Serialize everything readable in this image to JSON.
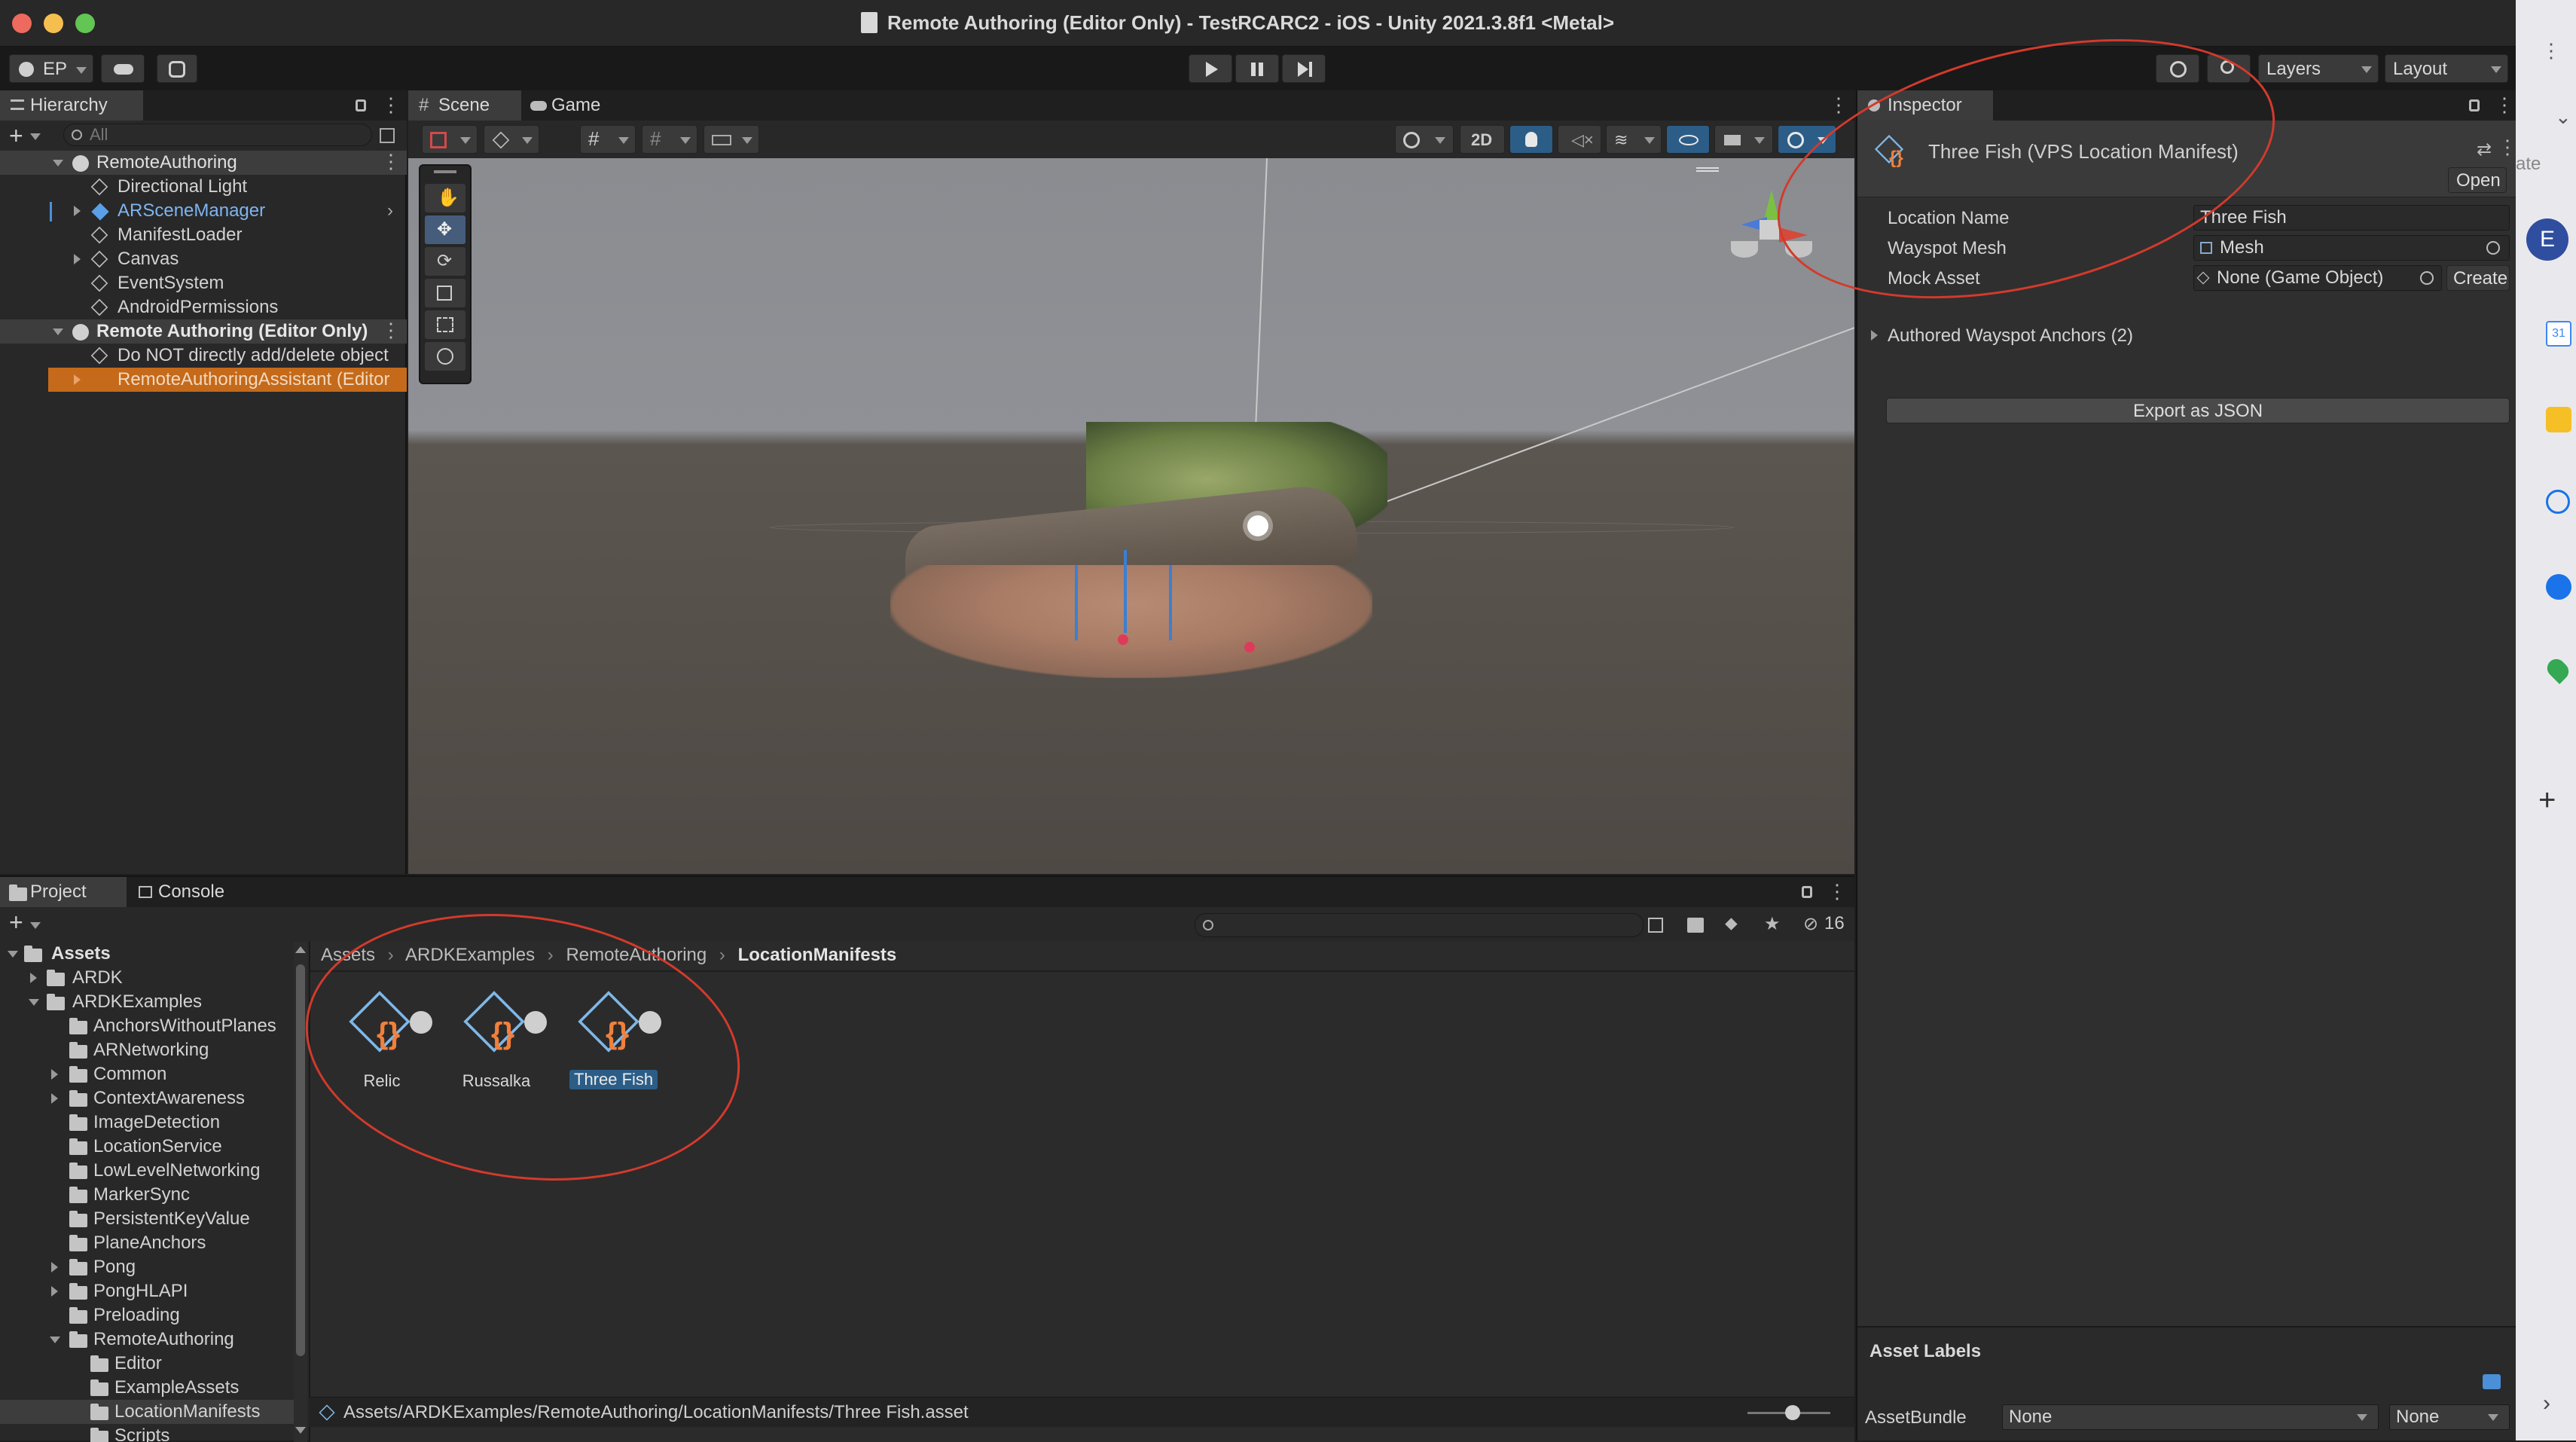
{
  "window": {
    "title": "Remote Authoring (Editor Only) - TestRCARC2 - iOS - Unity 2021.3.8f1 <Metal>"
  },
  "toolbar": {
    "account_label": "EP",
    "layers_label": "Layers",
    "layout_label": "Layout"
  },
  "hierarchy": {
    "tab_label": "Hierarchy",
    "search_placeholder": "All",
    "items": [
      {
        "label": "RemoteAuthoring",
        "indent": 0,
        "kind": "scene"
      },
      {
        "label": "Directional Light",
        "indent": 1,
        "kind": "object"
      },
      {
        "label": "ARSceneManager",
        "indent": 1,
        "kind": "prefab"
      },
      {
        "label": "ManifestLoader",
        "indent": 1,
        "kind": "object"
      },
      {
        "label": "Canvas",
        "indent": 1,
        "kind": "object"
      },
      {
        "label": "EventSystem",
        "indent": 1,
        "kind": "object"
      },
      {
        "label": "AndroidPermissions",
        "indent": 1,
        "kind": "object"
      },
      {
        "label": "Remote Authoring (Editor Only)",
        "indent": 0,
        "kind": "scene"
      },
      {
        "label": "Do NOT directly add/delete object",
        "indent": 1,
        "kind": "object"
      },
      {
        "label": "RemoteAuthoringAssistant (Editor",
        "indent": 1,
        "kind": "selected"
      }
    ]
  },
  "scene_view": {
    "tabs": [
      "Scene",
      "Game"
    ],
    "mode_2d": "2D"
  },
  "inspector": {
    "tab_label": "Inspector",
    "object_title": "Three Fish (VPS Location Manifest)",
    "open_button": "Open",
    "fields": {
      "location_name_label": "Location Name",
      "location_name_value": "Three Fish",
      "wayspot_mesh_label": "Wayspot Mesh",
      "wayspot_mesh_value": "Mesh",
      "mock_asset_label": "Mock Asset",
      "mock_asset_value": "None (Game Object)",
      "create_button": "Create"
    },
    "foldout_label": "Authored Wayspot Anchors (2)",
    "export_button": "Export as JSON",
    "asset_labels_title": "Asset Labels",
    "assetbundle_label": "AssetBundle",
    "assetbundle_value": "None",
    "assetbundle_variant": "None"
  },
  "project": {
    "tabs": [
      "Project",
      "Console"
    ],
    "hidden_count": "16",
    "breadcrumb": [
      "Assets",
      "ARDKExamples",
      "RemoteAuthoring",
      "LocationManifests"
    ],
    "tree": [
      {
        "label": "Assets",
        "indent": 0,
        "expanded": true,
        "bold": true
      },
      {
        "label": "ARDK",
        "indent": 1,
        "expandable": true
      },
      {
        "label": "ARDKExamples",
        "indent": 1,
        "expanded": true
      },
      {
        "label": "AnchorsWithoutPlanes",
        "indent": 2
      },
      {
        "label": "ARNetworking",
        "indent": 2
      },
      {
        "label": "Common",
        "indent": 2,
        "expandable": true
      },
      {
        "label": "ContextAwareness",
        "indent": 2,
        "expandable": true
      },
      {
        "label": "ImageDetection",
        "indent": 2
      },
      {
        "label": "LocationService",
        "indent": 2
      },
      {
        "label": "LowLevelNetworking",
        "indent": 2
      },
      {
        "label": "MarkerSync",
        "indent": 2
      },
      {
        "label": "PersistentKeyValue",
        "indent": 2
      },
      {
        "label": "PlaneAnchors",
        "indent": 2
      },
      {
        "label": "Pong",
        "indent": 2,
        "expandable": true
      },
      {
        "label": "PongHLAPI",
        "indent": 2,
        "expandable": true
      },
      {
        "label": "Preloading",
        "indent": 2
      },
      {
        "label": "RemoteAuthoring",
        "indent": 2,
        "expanded": true
      },
      {
        "label": "Editor",
        "indent": 3
      },
      {
        "label": "ExampleAssets",
        "indent": 3
      },
      {
        "label": "LocationManifests",
        "indent": 3,
        "selected": true
      },
      {
        "label": "Scripts",
        "indent": 3
      }
    ],
    "assets": [
      {
        "label": "Relic"
      },
      {
        "label": "Russalka"
      },
      {
        "label": "Three Fish",
        "selected": true
      }
    ],
    "footer_path": "Assets/ARDKExamples/RemoteAuthoring/LocationManifests/Three Fish.asset"
  },
  "side_strip": {
    "avatar_letter": "E",
    "partial_text": "ate",
    "calendar_num": "31"
  },
  "colors": {
    "accent_blue": "#2c5d87",
    "selection_orange": "#c46a1a",
    "annotation_red": "#d33a2c"
  }
}
